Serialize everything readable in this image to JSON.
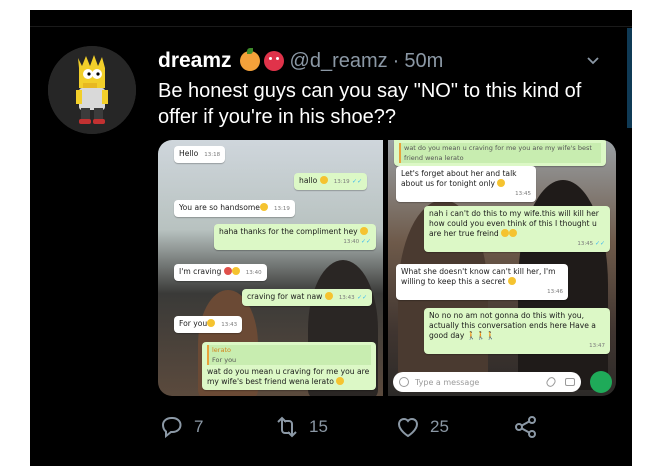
{
  "tweet": {
    "display_name": "dreamz",
    "handle": "@d_reamz",
    "separator": "·",
    "time": "50m",
    "text": "Be honest guys can you say \"NO\" to this kind of offer if you're in his shoe??"
  },
  "chat_left": {
    "messages": [
      {
        "text": "Hello",
        "time": "13:18"
      },
      {
        "text": "hallo",
        "time": "13:19"
      },
      {
        "text": "You are so handsome",
        "time": "13:19"
      },
      {
        "text": "haha thanks for the compliment hey",
        "time": "13:40"
      },
      {
        "text": "I'm craving",
        "time": "13:40"
      },
      {
        "text": "craving for wat naw",
        "time": "13:43"
      },
      {
        "text": "For you",
        "time": "13:43"
      }
    ],
    "reply_quote": {
      "name": "lerato",
      "quoted": "For you"
    },
    "reply_text": "wat do you mean u craving for me you are my wife's best friend wena lerato"
  },
  "chat_right": {
    "top_quote": "wat do you mean u craving for me you are my wife's best friend wena lerato",
    "messages": [
      {
        "text": "Let's forget about her and talk about us for tonight only",
        "time": "13:45"
      },
      {
        "text": "nah i can't do this to my wife.this will kill her how could you even think of this I thought u are her true freind",
        "time": "13:45"
      },
      {
        "text": "What she doesn't know can't kill her, I'm willing to keep this a secret",
        "time": "13:46"
      },
      {
        "text": "No no no am not gonna do this with you, actually this conversation ends here Have a good day",
        "time": "13:47"
      }
    ],
    "input_placeholder": "Type a message"
  },
  "actions": {
    "reply_count": "7",
    "retweet_count": "15",
    "like_count": "25"
  },
  "colors": {
    "background": "#000000",
    "text": "#ffffff",
    "secondary": "#8b98a5",
    "bubble_out": "#dcf8c6",
    "bubble_in": "#ffffff"
  },
  "icons": [
    "reply-icon",
    "retweet-icon",
    "like-icon",
    "share-icon",
    "chevron-down-icon"
  ]
}
